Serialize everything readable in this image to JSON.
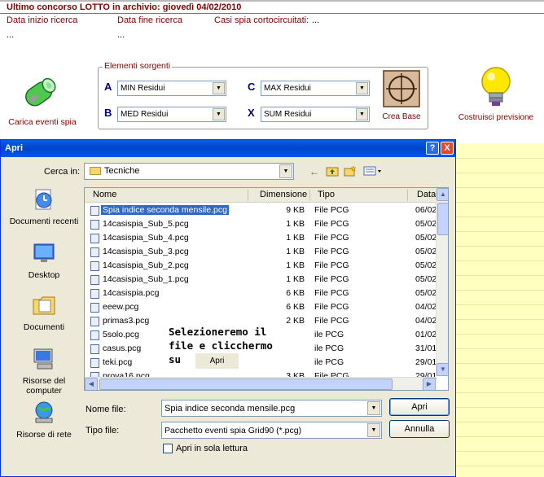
{
  "header": {
    "title": "Ultimo concorso LOTTO in archivio: giovedì 04/02/2010",
    "fields": [
      {
        "label": "Data inizio ricerca",
        "value": "..."
      },
      {
        "label": "Data fine ricerca",
        "value": "..."
      },
      {
        "label": "Casi spia cortocircuitati:",
        "value": "..."
      }
    ]
  },
  "toolbar": {
    "load_label": "Carica eventi spia",
    "crea_base_label": "Crea Base",
    "costruisci_label": "Costruisci previsione"
  },
  "sources": {
    "legend": "Elementi sorgenti",
    "items": [
      {
        "letter": "A",
        "value": "MIN Residui"
      },
      {
        "letter": "B",
        "value": "MED Residui"
      },
      {
        "letter": "C",
        "value": "MAX Residui"
      },
      {
        "letter": "X",
        "value": "SUM Residui"
      }
    ]
  },
  "dialog": {
    "title": "Apri",
    "cerca_label": "Cerca in:",
    "cerca_value": "Tecniche",
    "places": [
      {
        "label": "Documenti recenti",
        "icon": "recent-documents-icon"
      },
      {
        "label": "Desktop",
        "icon": "desktop-icon"
      },
      {
        "label": "Documenti",
        "icon": "documents-folder-icon"
      },
      {
        "label": "Risorse del computer",
        "icon": "my-computer-icon"
      },
      {
        "label": "Risorse di rete",
        "icon": "network-icon"
      }
    ],
    "columns": [
      "Nome",
      "Dimensione",
      "Tipo",
      "Data"
    ],
    "files": [
      {
        "name": "Spia indice seconda mensile.pcg",
        "size": "9 KB",
        "type": "File PCG",
        "date": "06/02"
      },
      {
        "name": "14casispia_Sub_5.pcg",
        "size": "1 KB",
        "type": "File PCG",
        "date": "05/02"
      },
      {
        "name": "14casispia_Sub_4.pcg",
        "size": "1 KB",
        "type": "File PCG",
        "date": "05/02"
      },
      {
        "name": "14casispia_Sub_3.pcg",
        "size": "1 KB",
        "type": "File PCG",
        "date": "05/02"
      },
      {
        "name": "14casispia_Sub_2.pcg",
        "size": "1 KB",
        "type": "File PCG",
        "date": "05/02"
      },
      {
        "name": "14casispia_Sub_1.pcg",
        "size": "1 KB",
        "type": "File PCG",
        "date": "05/02"
      },
      {
        "name": "14casispia.pcg",
        "size": "6 KB",
        "type": "File PCG",
        "date": "05/02"
      },
      {
        "name": "eeew.pcg",
        "size": "6 KB",
        "type": "File PCG",
        "date": "04/02"
      },
      {
        "name": "primas3.pcg",
        "size": "2 KB",
        "type": "File PCG",
        "date": "04/02"
      },
      {
        "name": "5solo.pcg",
        "size": "",
        "type": "ile PCG",
        "date": "01/02"
      },
      {
        "name": "casus.pcg",
        "size": "",
        "type": "ile PCG",
        "date": "31/01"
      },
      {
        "name": "teki.pcg",
        "size": "",
        "type": "ile PCG",
        "date": "29/01"
      },
      {
        "name": "prova16.pcg",
        "size": "3 KB",
        "type": "File PCG",
        "date": "29/01"
      }
    ],
    "selected_index": 0,
    "nome_label": "Nome file:",
    "nome_value": "Spia indice seconda mensile.pcg",
    "tipo_label": "Tipo file:",
    "tipo_value": "Pacchetto eventi spia Grid90 (*.pcg)",
    "apri_button": "Apri",
    "annulla_button": "Annulla",
    "readonly_label": "Apri in sola lettura",
    "help_button": "?",
    "close_button": "X"
  },
  "overlay": {
    "line1": "Selezioneremo il",
    "line2": "file e clicchermo",
    "line3": "su",
    "button": "Apri"
  }
}
